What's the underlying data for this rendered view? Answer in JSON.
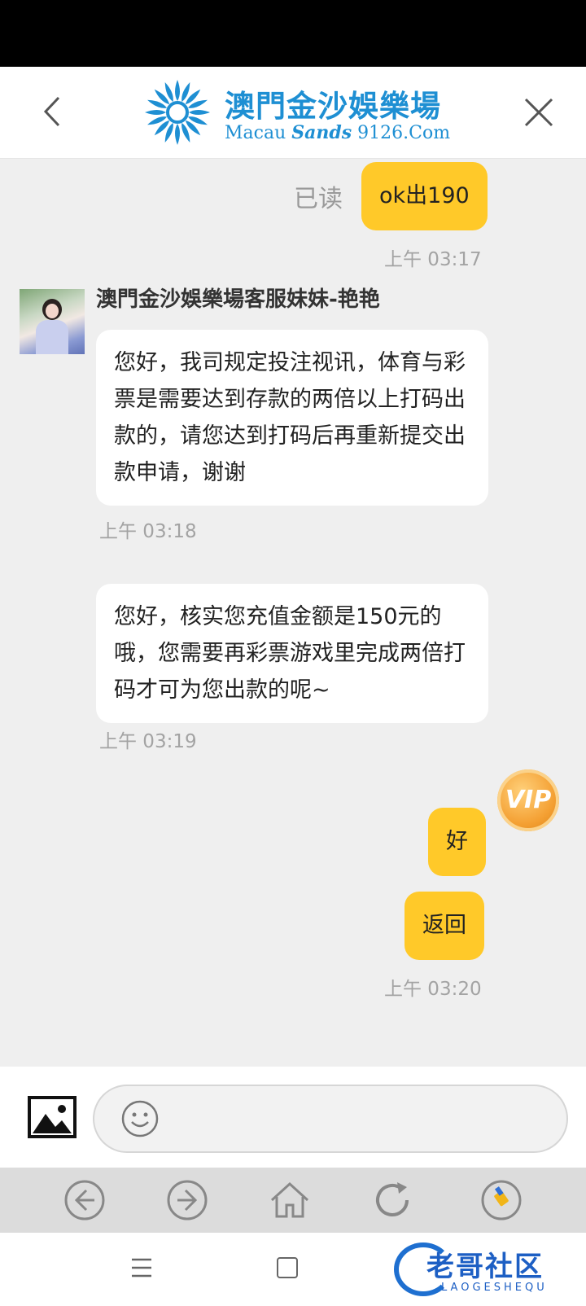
{
  "header": {
    "logo_cn": "澳門金沙娛樂場",
    "logo_en_prefix": "Macau ",
    "logo_en_brand": "Sands",
    "logo_en_suffix": " 9126.Com",
    "back_icon": "chevron-left-icon",
    "close_icon": "close-icon"
  },
  "messages": {
    "m1": {
      "text": "ok出190",
      "status": "已读",
      "time": "上午 03:17"
    },
    "sender_name": "澳門金沙娛樂場客服妹妹-艳艳",
    "m2": {
      "text": "您好，我司规定投注视讯，体育与彩票是需要达到存款的两倍以上打码出款的，请您达到打码后再重新提交出款申请，谢谢",
      "time": "上午 03:18"
    },
    "m3": {
      "text": "您好，核实您充值金额是150元的哦，您需要再彩票游戏里完成两倍打码才可为您出款的呢~",
      "time": "上午 03:19"
    },
    "m4": {
      "text": "好"
    },
    "m5": {
      "text": "返回",
      "time": "上午 03:20"
    }
  },
  "vip_badge": "VIP",
  "input": {
    "placeholder": "",
    "image_icon": "image-icon",
    "emoji_icon": "emoji-icon"
  },
  "browser_toolbar": [
    "back-icon",
    "forward-icon",
    "home-icon",
    "refresh-icon",
    "clean-icon"
  ],
  "watermark": {
    "cn": "老哥社区",
    "en": "LAOGESHEQU"
  },
  "colors": {
    "accent": "#ffc929",
    "logo_blue": "#1e8fd3",
    "bg": "#efefef"
  }
}
